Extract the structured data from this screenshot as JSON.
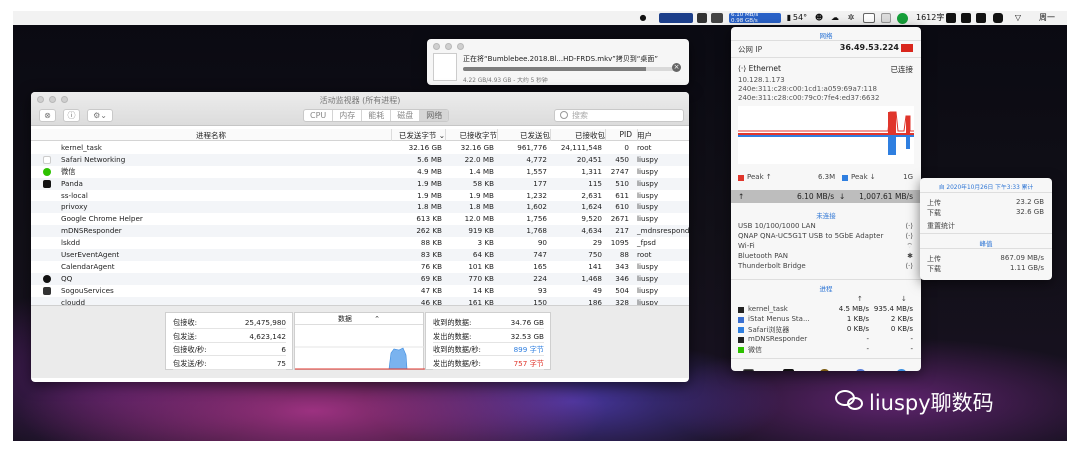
{
  "menubar": {
    "net_up": "6.10 MB/s",
    "net_down": "0.98 GB/s",
    "temp": "54°",
    "rpm": "1612字",
    "weekday": "周一"
  },
  "copy_dialog": {
    "title": "正在将“Bumblebee.2018.Bl...HD-FRDS.mkv”拷贝到“桌面”",
    "status": "4.22 GB/4.93 GB - 大约 5 秒钟",
    "progress": 0.856
  },
  "activity_monitor": {
    "title": "活动监视器 (所有进程)",
    "tabs": [
      "CPU",
      "内存",
      "能耗",
      "磁盘",
      "网络"
    ],
    "active_tab": "网络",
    "search_placeholder": "搜索",
    "columns": [
      "进程名称",
      "已发送字节 ⌄",
      "已接收字节",
      "已发送包",
      "已接收包",
      "PID",
      "用户"
    ],
    "rows": [
      {
        "icon": "none",
        "name": "kernel_task",
        "sent": "32.16 GB",
        "recv": "32.16 GB",
        "spk": "961,776",
        "rpk": "24,111,548",
        "pid": "0",
        "user": "root"
      },
      {
        "icon": "doc",
        "name": "Safari Networking",
        "sent": "5.6 MB",
        "recv": "22.0 MB",
        "spk": "4,772",
        "rpk": "20,451",
        "pid": "450",
        "user": "liuspy"
      },
      {
        "icon": "wechat",
        "name": "微信",
        "sent": "4.9 MB",
        "recv": "1.4 MB",
        "spk": "1,557",
        "rpk": "1,311",
        "pid": "2747",
        "user": "liuspy"
      },
      {
        "icon": "panda",
        "name": "Panda",
        "sent": "1.9 MB",
        "recv": "58 KB",
        "spk": "177",
        "rpk": "115",
        "pid": "510",
        "user": "liuspy"
      },
      {
        "icon": "none",
        "name": "ss-local",
        "sent": "1.9 MB",
        "recv": "1.9 MB",
        "spk": "1,232",
        "rpk": "2,631",
        "pid": "611",
        "user": "liuspy"
      },
      {
        "icon": "none",
        "name": "privoxy",
        "sent": "1.8 MB",
        "recv": "1.8 MB",
        "spk": "1,602",
        "rpk": "1,624",
        "pid": "610",
        "user": "liuspy"
      },
      {
        "icon": "none",
        "name": "Google Chrome Helper",
        "sent": "613 KB",
        "recv": "12.0 MB",
        "spk": "1,756",
        "rpk": "9,520",
        "pid": "2671",
        "user": "liuspy"
      },
      {
        "icon": "none",
        "name": "mDNSResponder",
        "sent": "262 KB",
        "recv": "919 KB",
        "spk": "1,768",
        "rpk": "4,634",
        "pid": "217",
        "user": "_mdnsrespond"
      },
      {
        "icon": "none",
        "name": "lskdd",
        "sent": "88 KB",
        "recv": "3 KB",
        "spk": "90",
        "rpk": "29",
        "pid": "1095",
        "user": "_fpsd"
      },
      {
        "icon": "none",
        "name": "UserEventAgent",
        "sent": "83 KB",
        "recv": "64 KB",
        "spk": "747",
        "rpk": "750",
        "pid": "88",
        "user": "root"
      },
      {
        "icon": "none",
        "name": "CalendarAgent",
        "sent": "76 KB",
        "recv": "101 KB",
        "spk": "165",
        "rpk": "141",
        "pid": "343",
        "user": "liuspy"
      },
      {
        "icon": "qq",
        "name": "QQ",
        "sent": "69 KB",
        "recv": "770 KB",
        "spk": "224",
        "rpk": "1,468",
        "pid": "346",
        "user": "liuspy"
      },
      {
        "icon": "sogou",
        "name": "SogouServices",
        "sent": "47 KB",
        "recv": "14 KB",
        "spk": "93",
        "rpk": "49",
        "pid": "504",
        "user": "liuspy"
      },
      {
        "icon": "none",
        "name": "cloudd",
        "sent": "46 KB",
        "recv": "161 KB",
        "spk": "150",
        "rpk": "186",
        "pid": "328",
        "user": "liuspy"
      }
    ],
    "stats_left": [
      {
        "k": "包接收:",
        "v": "25,475,980"
      },
      {
        "k": "包发送:",
        "v": "4,623,142"
      },
      {
        "k": "包接收/秒:",
        "v": "6"
      },
      {
        "k": "包发送/秒:",
        "v": "75"
      }
    ],
    "graph_select": "数据",
    "stats_right": [
      {
        "k": "收到的数据:",
        "v": "34.76 GB",
        "color": "#222"
      },
      {
        "k": "发出的数据:",
        "v": "32.53 GB",
        "color": "#222"
      },
      {
        "k": "收到的数据/秒:",
        "v": "899 字节",
        "color": "#2f7fe0"
      },
      {
        "k": "发出的数据/秒:",
        "v": "757 字节",
        "color": "#e0362c"
      }
    ]
  },
  "istat": {
    "section_network": "网络",
    "public_ip_label": "公网 IP",
    "public_ip": "36.49.53.224",
    "ethernet_label": "Ethernet",
    "ethernet_status": "已连接",
    "addresses": [
      "10.128.1.173",
      "240e:311:c28:c00:1cd1:a059:69a7:118",
      "240e:311:c28:c00:79c0:7fe4:ed37:6632"
    ],
    "peak_up": "Peak ↑",
    "peak_up_val": "6.3M",
    "peak_down": "Peak ↓",
    "peak_down_val": "1G",
    "rate_up": "6.10 MB/s",
    "rate_down": "1,007.61 MB/s",
    "section_disconnected": "未连接",
    "interfaces": [
      "USB 10/100/1000 LAN",
      "QNAP QNA-UC5G1T USB to 5GbE Adapter",
      "Wi-Fi",
      "Bluetooth PAN",
      "Thunderbolt Bridge"
    ],
    "section_process": "进程",
    "proc_rows": [
      {
        "name": "kernel_task",
        "up": "4.5 MB/s",
        "down": "935.4 MB/s"
      },
      {
        "name": "iStat Menus Sta...",
        "up": "1 KB/s",
        "down": "2 KB/s"
      },
      {
        "name": "Safari浏览器",
        "up": "0 KB/s",
        "down": "0 KB/s"
      },
      {
        "name": "mDNSResponder",
        "up": "-",
        "down": "-"
      },
      {
        "name": "微信",
        "up": "-",
        "down": "-"
      }
    ]
  },
  "history": {
    "title": "自 2020年10月26日 下午3:33 累计",
    "up_label": "上传",
    "up_val": "23.2 GB",
    "down_label": "下载",
    "down_val": "32.6 GB",
    "reset": "重置统计",
    "peak_title": "峰值",
    "peak_up_label": "上传",
    "peak_up_val": "867.09 MB/s",
    "peak_down_label": "下载",
    "peak_down_val": "1.11 GB/s"
  },
  "watermark": "liuspy聊数码",
  "colors": {
    "red": "#e0362c",
    "blue": "#2f7fe0",
    "accent": "#2a73d4"
  }
}
